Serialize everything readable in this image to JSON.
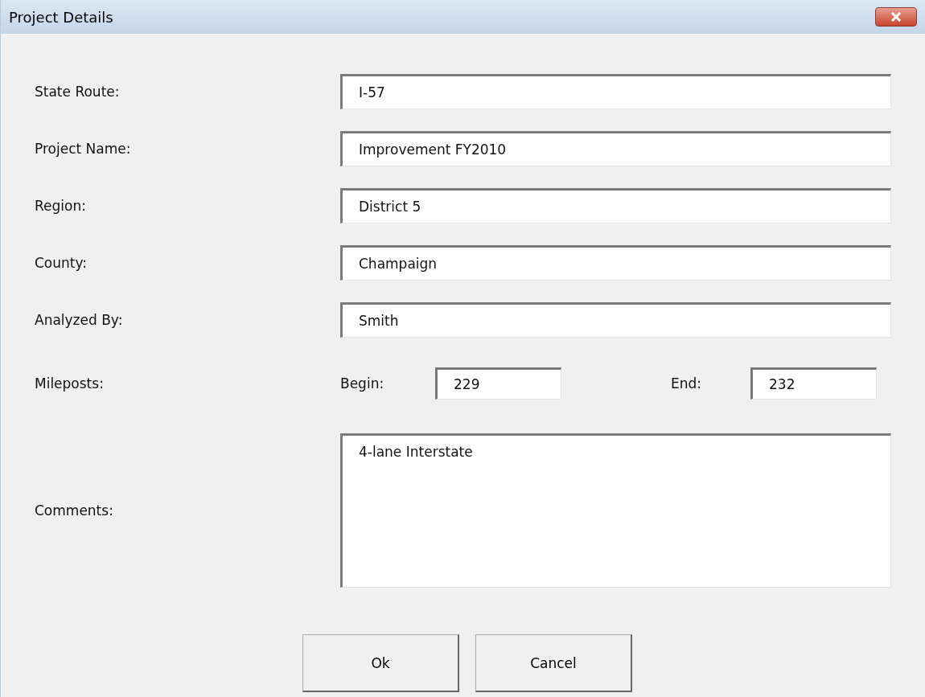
{
  "window": {
    "title": "Project Details"
  },
  "fields": [
    {
      "label": "State Route:",
      "value": "I-57"
    },
    {
      "label": "Project Name:",
      "value": "Improvement FY2010"
    },
    {
      "label": "Region:",
      "value": "District 5"
    },
    {
      "label": "County:",
      "value": "Champaign"
    },
    {
      "label": "Analyzed By:",
      "value": "Smith"
    }
  ],
  "mileposts": {
    "label": "Mileposts:",
    "begin": {
      "label": "Begin:",
      "value": "229"
    },
    "end": {
      "label": "End:",
      "value": "232"
    }
  },
  "comments": {
    "label": "Comments:",
    "value": "4-lane Interstate"
  },
  "buttons": [
    "Ok",
    "Cancel"
  ]
}
